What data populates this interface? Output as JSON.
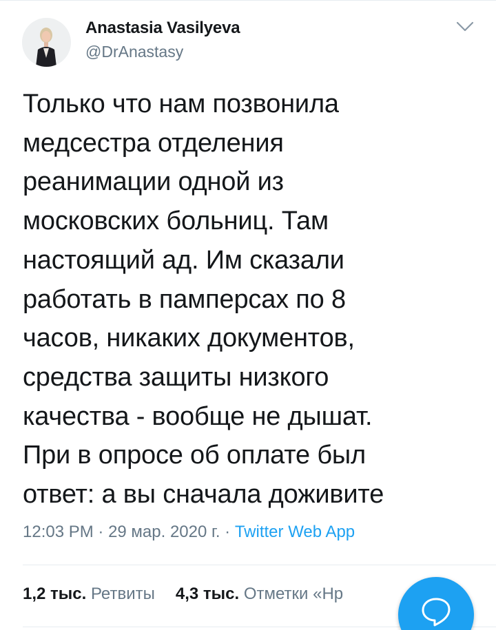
{
  "user": {
    "display_name": "Anastasia Vasilyeva",
    "handle": "@DrAnastasy"
  },
  "tweet": {
    "lines": [
      "Только что нам позвонила",
      "медсестра отделения",
      "реанимации одной из",
      "московских больниц. Там",
      "настоящий ад. Им сказали",
      "работать в памперсах по 8",
      "часов, никаких документов,",
      "средства защиты низкого",
      "качества - вообще не дышат.",
      "При в опросе об оплате был",
      "ответ: а вы сначала доживите"
    ]
  },
  "meta": {
    "time": "12:03 PM",
    "sep1": " · ",
    "date": "29 мар. 2020 г.",
    "sep2": " · ",
    "source": "Twitter Web App"
  },
  "stats": {
    "retweets_count": "1,2 тыс.",
    "retweets_label": "Ретвиты",
    "likes_count": "4,3 тыс.",
    "likes_label": "Отметки «Нр"
  },
  "colors": {
    "accent": "#1da1f2",
    "secondary_text": "#657786",
    "primary_text": "#14171a",
    "divider": "#e6ecf0"
  },
  "icons": {
    "menu": "chevron-down-icon",
    "compose": "reply-bubble-icon"
  }
}
